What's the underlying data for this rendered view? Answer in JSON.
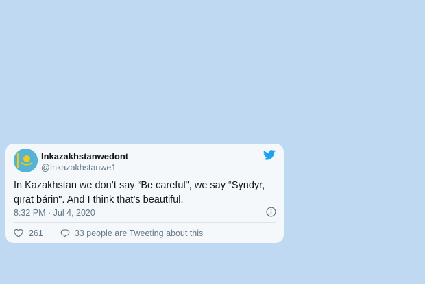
{
  "tweet": {
    "display_name": "Inkazakhstanwedont",
    "handle": "@Inkazakhstanwe1",
    "text": "In Kazakhstan we don’t say “Be careful\", we say “Syndyr, qırat bárin\". And I think that’s beautiful.",
    "timestamp": "8:32 PM · Jul 4, 2020",
    "like_count": "261",
    "conversation_text": "33 people are Tweeting about this"
  },
  "icons": {
    "logo": "twitter-bird-icon",
    "info": "info-icon",
    "like": "heart-icon",
    "reply": "speech-bubble-icon",
    "avatar": "kazakhstan-flag-avatar"
  },
  "colors": {
    "page_background": "#bfd9f2",
    "card_background": "#f5f8fa",
    "twitter_blue": "#1da1f2",
    "secondary_text": "#657786",
    "primary_text": "#14171a",
    "flag_blue": "#55b4d6",
    "flag_gold": "#f2c918"
  }
}
